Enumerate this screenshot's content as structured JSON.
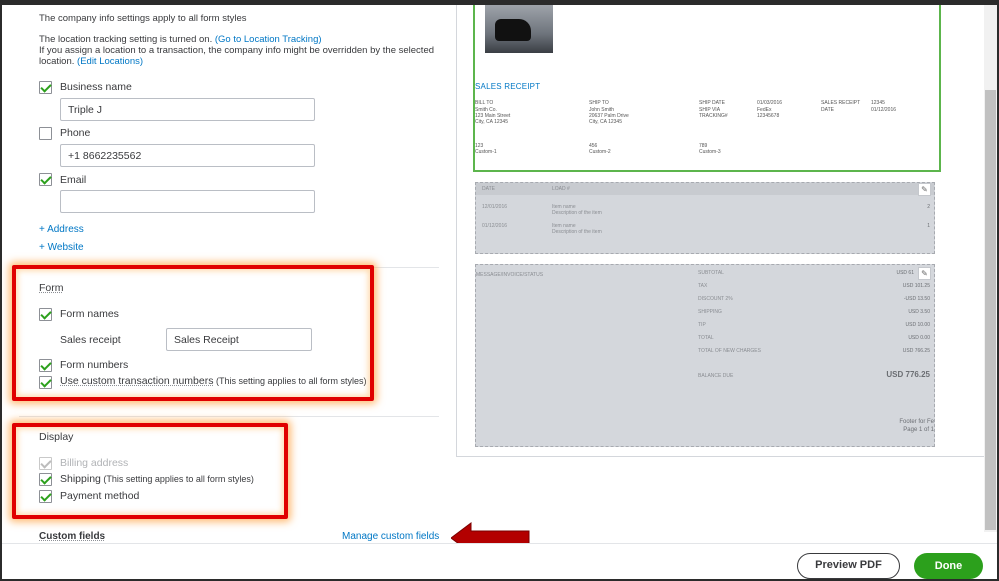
{
  "company_info": {
    "note": "The company info settings apply to all form styles",
    "location_line1_prefix": "The location tracking setting is turned on. ",
    "location_link": "(Go to Location Tracking)",
    "location_line2": "If you assign a location to a transaction, the company info might be overridden by the selected",
    "location_line3_prefix": "location. ",
    "edit_locations_link": "(Edit Locations)",
    "business_name_label": "Business name",
    "business_name_value": "Triple J",
    "business_name_checked": true,
    "phone_label": "Phone",
    "phone_value": "+1 8662235562",
    "phone_checked": false,
    "email_label": "Email",
    "email_value": "",
    "email_checked": true,
    "add_address": "+ Address",
    "add_website": "+ Website"
  },
  "form_section": {
    "title": "Form",
    "form_names_label": "Form names",
    "sales_receipt_label": "Sales receipt",
    "sales_receipt_value": "Sales Receipt",
    "form_numbers_label": "Form numbers",
    "custom_numbers_label": "Use custom transaction numbers",
    "custom_numbers_note": " (This setting applies to all form styles)"
  },
  "display_section": {
    "title": "Display",
    "billing_address_label": "Billing address",
    "shipping_label": "Shipping",
    "shipping_note": " (This setting applies to all form styles)",
    "payment_method_label": "Payment method"
  },
  "custom_fields": {
    "title": "Custom fields",
    "manage_link": "Manage custom fields"
  },
  "preview": {
    "sales_receipt_title": "SALES RECEIPT",
    "bill_to_label": "BILL TO",
    "bill_to_lines": [
      "Smith Co.",
      "123 Main Street",
      "City, CA 12345"
    ],
    "ship_to_label": "SHIP TO",
    "ship_to_lines": [
      "John Smith",
      "20637 Palm Drive",
      "City, CA 12345"
    ],
    "ship_date_label": "SHIP DATE",
    "ship_date_value": "01/03/2016",
    "ship_via_label": "SHIP VIA",
    "ship_via_value": "FedEx",
    "tracking_label": "TRACKING#",
    "tracking_value": "12345678",
    "sales_receipt_no_label": "SALES RECEIPT",
    "sales_receipt_no_value": "12345",
    "date_label": "DATE",
    "date_value": "01/12/2016",
    "custom_values": [
      "123",
      "456",
      "789"
    ],
    "custom_labels": [
      "Custom-1",
      "Custom-2",
      "Custom-3"
    ],
    "table_header": [
      "DATE",
      "LOAD #"
    ],
    "rows": [
      {
        "date": "12/01/2016",
        "name": "Item name",
        "desc": "Description of the item",
        "qty": "2"
      },
      {
        "date": "01/12/2016",
        "name": "Item name",
        "desc": "Description of the item",
        "qty": "1"
      }
    ],
    "message_label": "MESSAGE/INVOICE/STATUS",
    "totals": [
      {
        "label": "SUBTOTAL",
        "value": "USD 61"
      },
      {
        "label": "TAX",
        "value": "USD 101.25"
      },
      {
        "label": "DISCOUNT 2%",
        "value": "-USD 13.50"
      },
      {
        "label": "SHIPPING",
        "value": "USD 3.50"
      },
      {
        "label": "TIP",
        "value": "USD 10.00"
      },
      {
        "label": "TOTAL",
        "value": "USD 0.00"
      },
      {
        "label": "TOTAL OF NEW CHARGES",
        "value": "USD 766.25"
      }
    ],
    "balance_due_label": "BALANCE DUE",
    "balance_due_value": "USD 776.25",
    "footer_text": "Footer for Fe",
    "page_text": "Page 1 of 1"
  },
  "footer": {
    "preview_pdf": "Preview PDF",
    "done": "Done"
  },
  "colors": {
    "accent_green": "#2ca01c",
    "link_blue": "#0077c5",
    "highlight_red": "#e00000",
    "arrow_red": "#b30000"
  }
}
